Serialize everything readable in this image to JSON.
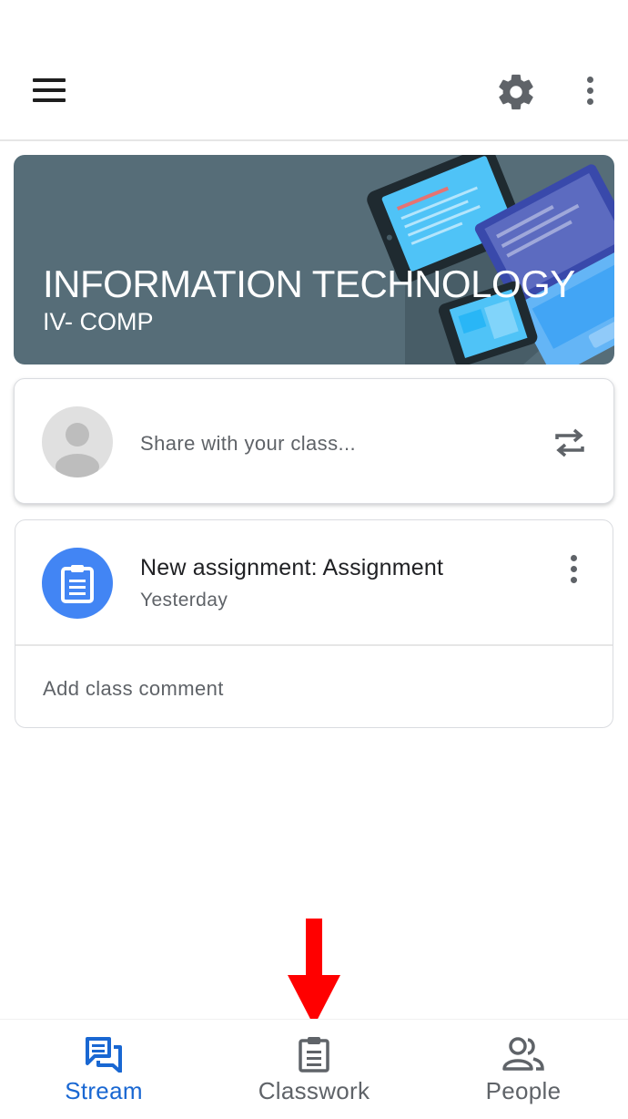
{
  "appbar": {
    "menu_icon": "menu-icon",
    "settings_icon": "gear-icon",
    "more_icon": "more-vert-icon"
  },
  "banner": {
    "title": "INFORMATION TECHNOLOGY",
    "section": "IV- COMP",
    "background_color": "#566d78"
  },
  "share": {
    "placeholder": "Share with your class...",
    "repost_icon": "repost-icon"
  },
  "post": {
    "title": "New assignment: Assignment",
    "date": "Yesterday",
    "comment_placeholder": "Add class comment",
    "icon": "assignment-icon",
    "icon_color": "#4285f4"
  },
  "bottom_nav": {
    "items": [
      {
        "label": "Stream",
        "icon": "stream-icon",
        "active": true
      },
      {
        "label": "Classwork",
        "icon": "classwork-icon",
        "active": false
      },
      {
        "label": "People",
        "icon": "people-icon",
        "active": false
      }
    ],
    "active_color": "#1967d2",
    "inactive_color": "#5f6368"
  },
  "annotation": {
    "arrow_color": "#ff0000"
  }
}
